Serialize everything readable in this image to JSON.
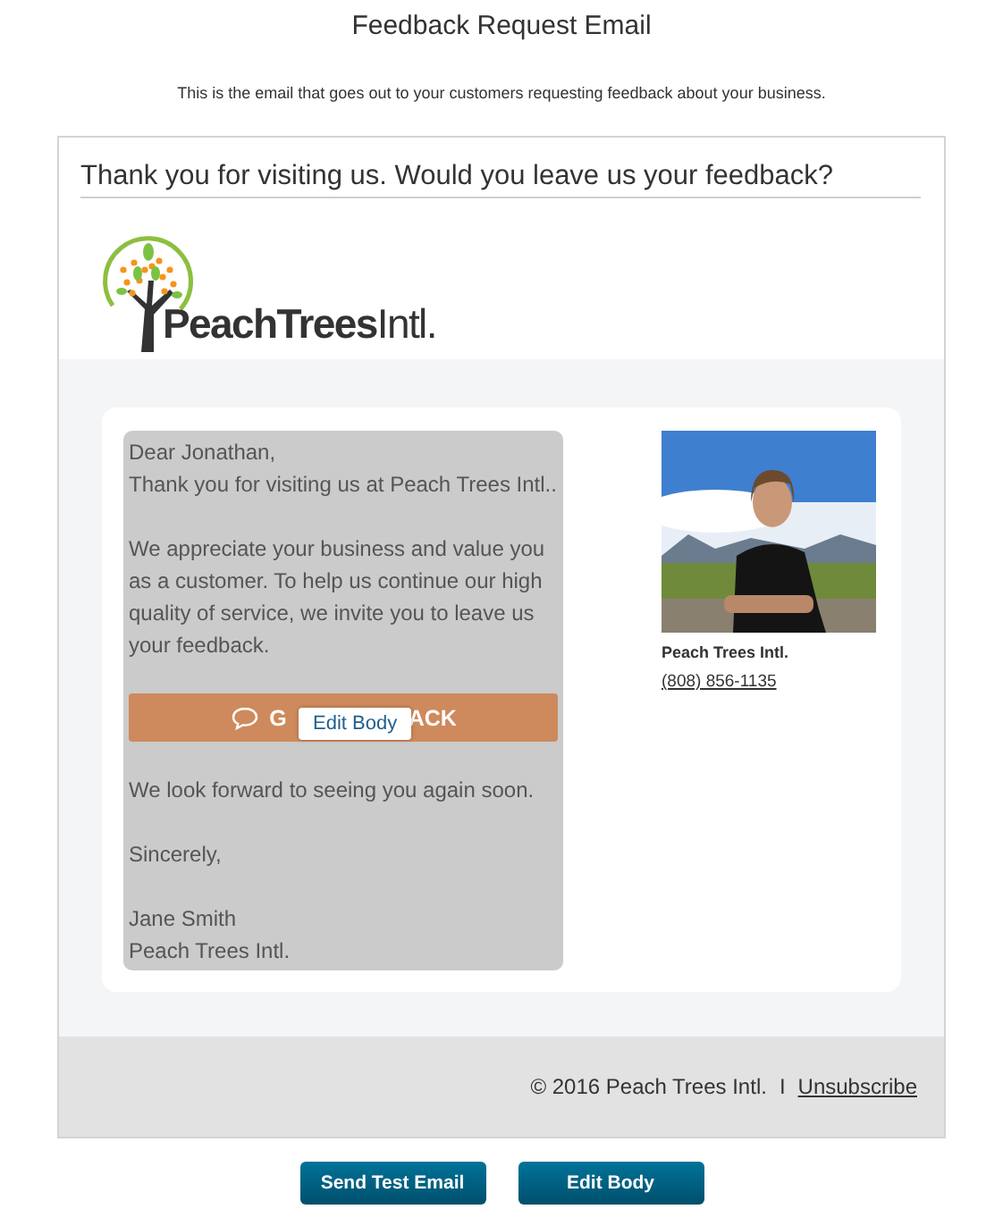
{
  "page": {
    "title": "Feedback Request Email",
    "description": "This is the email that goes out to your customers requesting feedback about your business."
  },
  "email": {
    "subject": "Thank you for visiting us. Would you leave us your feedback?",
    "logo": {
      "text": "**PeachTrees**Intl."
    },
    "body": {
      "greeting": [
        "Dear Jonathan,",
        "Thank you for visiting us at Peach Trees Intl.."
      ],
      "paragraph": "We appreciate your business and value you as a customer. To help us continue our high quality of service, we invite you to leave us your feedback.",
      "feedback_button": {
        "label_visible_start": "G",
        "label_visible_end": "ACK"
      },
      "edit_overlay": "Edit Body",
      "closing": "We look forward to seeing you again soon.",
      "signoff": "Sincerely,",
      "signature": [
        "Jane Smith",
        "Peach Trees Intl."
      ]
    },
    "contact": {
      "name": "Peach Trees Intl.",
      "phone": "(808) 856-1135"
    },
    "footer": {
      "copyright": "© 2016 Peach Trees Intl.",
      "separator": "I",
      "unsubscribe": "Unsubscribe"
    }
  },
  "buttons": [
    "Send Test Email",
    "Edit Body"
  ]
}
